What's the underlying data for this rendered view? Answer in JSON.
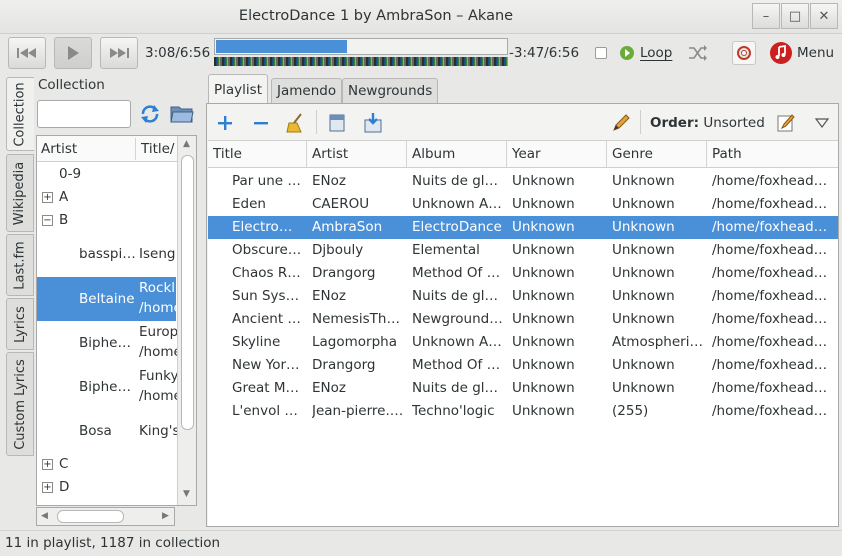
{
  "window": {
    "title": "ElectroDance 1 by AmbraSon – Akane"
  },
  "transport": {
    "elapsed": "3:08/6:56",
    "remaining": "-3:47/6:56",
    "progress_fraction": 0.45,
    "loop_label": "Loop",
    "menu_label": "Menu"
  },
  "sidebar_tabs": [
    "Collection",
    "Wikipedia",
    "Last.fm",
    "Lyrics",
    "Custom Lyrics"
  ],
  "collection": {
    "label": "Collection",
    "search_value": "",
    "columns": [
      "Artist",
      "Title/"
    ],
    "tree": [
      {
        "artist": "0-9",
        "title": "",
        "title2": ""
      },
      {
        "artist": "A",
        "title": "",
        "title2": ""
      },
      {
        "artist": "B",
        "title": "",
        "title2": ""
      },
      {
        "artist": "basspi…",
        "title": "Iseng",
        "title2": ""
      },
      {
        "artist": "Beltaine",
        "title": "Rockl",
        "title2": "/home"
      },
      {
        "artist": "Biphe…",
        "title": "Europ",
        "title2": "/home"
      },
      {
        "artist": "Biphe…",
        "title": "Funky",
        "title2": "/home"
      },
      {
        "artist": "Bosa",
        "title": "King's",
        "title2": ""
      },
      {
        "artist": "C",
        "title": "",
        "title2": ""
      },
      {
        "artist": "D",
        "title": "",
        "title2": ""
      }
    ]
  },
  "tabs": [
    "Playlist",
    "Jamendo",
    "Newgrounds"
  ],
  "playlist_toolbar": {
    "order_label": "Order:",
    "order_value": "Unsorted"
  },
  "playlist": {
    "columns": [
      "Title",
      "Artist",
      "Album",
      "Year",
      "Genre",
      "Path"
    ],
    "rows": [
      [
        "Par une l…",
        "ENoz",
        "Nuits de glace",
        "Unknown",
        "Unknown",
        "/home/foxhead1…"
      ],
      [
        "Eden",
        "CAEROU",
        "Unknown Al…",
        "Unknown",
        "Unknown",
        "/home/foxhead1…"
      ],
      [
        "ElectroD…",
        "AmbraSon",
        "ElectroDance",
        "Unknown",
        "Unknown",
        "/home/foxhead1…"
      ],
      [
        "Obscure …",
        "Djbouly",
        "Elemental",
        "Unknown",
        "Unknown",
        "/home/foxhead1…"
      ],
      [
        "Chaos R…",
        "Drangorg",
        "Method Of …",
        "Unknown",
        "Unknown",
        "/home/foxhead1…"
      ],
      [
        "Sun Syst…",
        "ENoz",
        "Nuits de glace",
        "Unknown",
        "Unknown",
        "/home/foxhead1…"
      ],
      [
        "Ancient …",
        "NemesisThe…",
        "Newground…",
        "Unknown",
        "Unknown",
        "/home/foxhead1…"
      ],
      [
        "Skyline",
        "Lagomorpha",
        "Unknown Al…",
        "Unknown",
        "Atmospheric…",
        "/home/foxhead1…"
      ],
      [
        "New Yor…",
        "Drangorg",
        "Method Of …",
        "Unknown",
        "Unknown",
        "/home/foxhead1…"
      ],
      [
        "Great Me…",
        "ENoz",
        "Nuits de glace",
        "Unknown",
        "Unknown",
        "/home/foxhead1…"
      ],
      [
        "L'envol d…",
        "Jean-pierre.…",
        "Techno'logic",
        "Unknown",
        "(255)",
        "/home/foxhead1…"
      ]
    ]
  },
  "status": {
    "text": "11 in playlist, 1187 in collection"
  }
}
